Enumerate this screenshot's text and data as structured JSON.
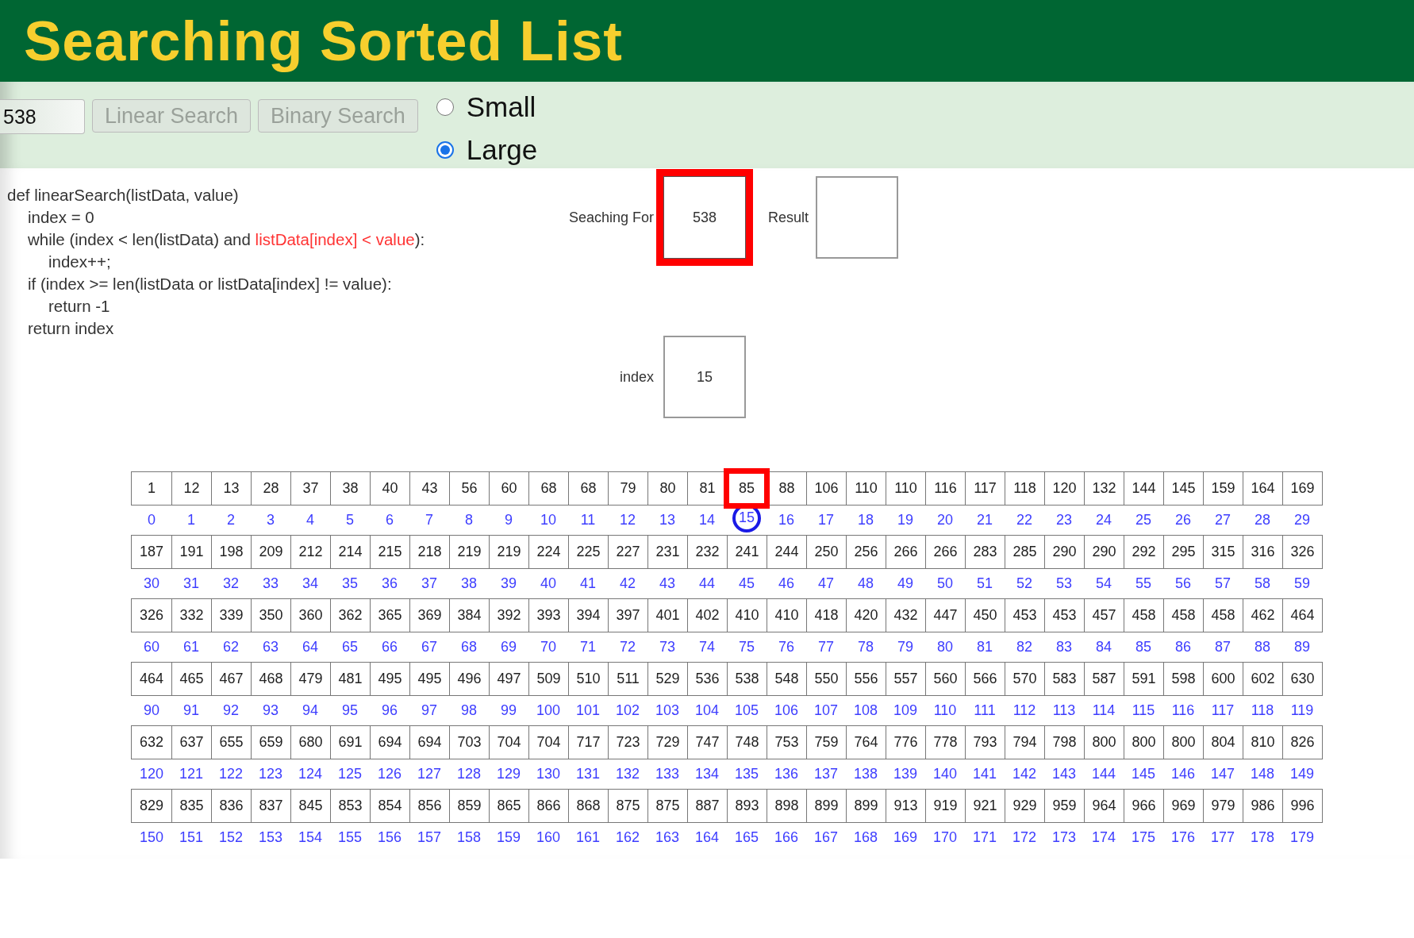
{
  "header": {
    "title": "Searching Sorted List"
  },
  "controls": {
    "value_field": {
      "value": "538"
    },
    "buttons": [
      {
        "label": "Linear Search",
        "disabled": true
      },
      {
        "label": "Binary Search",
        "disabled": true
      }
    ],
    "size_options": [
      {
        "label": "Small",
        "selected": false
      },
      {
        "label": "Large",
        "selected": true
      }
    ]
  },
  "code": {
    "lines": [
      {
        "parts": [
          {
            "text": "def linearSearch(listData, value)",
            "highlighted": false
          }
        ],
        "children": [
          {
            "parts": [
              {
                "text": "index = 0",
                "highlighted": false
              }
            ]
          },
          {
            "parts": [
              {
                "text": "while (index < len(listData) and ",
                "highlighted": false
              },
              {
                "text": "listData[index] < value",
                "highlighted": true
              },
              {
                "text": "):",
                "highlighted": false
              }
            ],
            "children": [
              {
                "parts": [
                  {
                    "text": "index++;",
                    "highlighted": false
                  }
                ]
              }
            ]
          },
          {
            "parts": [
              {
                "text": "if (index >= len(listData or listData[index] != value):",
                "highlighted": false
              }
            ],
            "children": [
              {
                "parts": [
                  {
                    "text": "return -1",
                    "highlighted": false
                  }
                ]
              }
            ]
          },
          {
            "parts": [
              {
                "text": "return index",
                "highlighted": false
              }
            ]
          }
        ]
      }
    ]
  },
  "variables": {
    "searching_for": {
      "label": "Seaching For",
      "value": "538"
    },
    "result": {
      "label": "Result"
    },
    "index": {
      "label": "index",
      "value": "15"
    }
  },
  "list": {
    "items": [
      {
        "value": "1",
        "index": "0",
        "selected": false
      },
      {
        "value": "12",
        "index": "1",
        "selected": false
      },
      {
        "value": "13",
        "index": "2",
        "selected": false
      },
      {
        "value": "28",
        "index": "3",
        "selected": false
      },
      {
        "value": "37",
        "index": "4",
        "selected": false
      },
      {
        "value": "38",
        "index": "5",
        "selected": false
      },
      {
        "value": "40",
        "index": "6",
        "selected": false
      },
      {
        "value": "43",
        "index": "7",
        "selected": false
      },
      {
        "value": "56",
        "index": "8",
        "selected": false
      },
      {
        "value": "60",
        "index": "9",
        "selected": false
      },
      {
        "value": "68",
        "index": "10",
        "selected": false
      },
      {
        "value": "68",
        "index": "11",
        "selected": false
      },
      {
        "value": "79",
        "index": "12",
        "selected": false
      },
      {
        "value": "80",
        "index": "13",
        "selected": false
      },
      {
        "value": "81",
        "index": "14",
        "selected": false
      },
      {
        "value": "85",
        "index": "15",
        "selected": true
      },
      {
        "value": "88",
        "index": "16",
        "selected": false
      },
      {
        "value": "106",
        "index": "17",
        "selected": false
      },
      {
        "value": "110",
        "index": "18",
        "selected": false
      },
      {
        "value": "110",
        "index": "19",
        "selected": false
      },
      {
        "value": "116",
        "index": "20",
        "selected": false
      },
      {
        "value": "117",
        "index": "21",
        "selected": false
      },
      {
        "value": "118",
        "index": "22",
        "selected": false
      },
      {
        "value": "120",
        "index": "23",
        "selected": false
      },
      {
        "value": "132",
        "index": "24",
        "selected": false
      },
      {
        "value": "144",
        "index": "25",
        "selected": false
      },
      {
        "value": "145",
        "index": "26",
        "selected": false
      },
      {
        "value": "159",
        "index": "27",
        "selected": false
      },
      {
        "value": "164",
        "index": "28",
        "selected": false
      },
      {
        "value": "169",
        "index": "29",
        "selected": false
      },
      {
        "value": "187",
        "index": "30",
        "selected": false
      },
      {
        "value": "191",
        "index": "31",
        "selected": false
      },
      {
        "value": "198",
        "index": "32",
        "selected": false
      },
      {
        "value": "209",
        "index": "33",
        "selected": false
      },
      {
        "value": "212",
        "index": "34",
        "selected": false
      },
      {
        "value": "214",
        "index": "35",
        "selected": false
      },
      {
        "value": "215",
        "index": "36",
        "selected": false
      },
      {
        "value": "218",
        "index": "37",
        "selected": false
      },
      {
        "value": "219",
        "index": "38",
        "selected": false
      },
      {
        "value": "219",
        "index": "39",
        "selected": false
      },
      {
        "value": "224",
        "index": "40",
        "selected": false
      },
      {
        "value": "225",
        "index": "41",
        "selected": false
      },
      {
        "value": "227",
        "index": "42",
        "selected": false
      },
      {
        "value": "231",
        "index": "43",
        "selected": false
      },
      {
        "value": "232",
        "index": "44",
        "selected": false
      },
      {
        "value": "241",
        "index": "45",
        "selected": false
      },
      {
        "value": "244",
        "index": "46",
        "selected": false
      },
      {
        "value": "250",
        "index": "47",
        "selected": false
      },
      {
        "value": "256",
        "index": "48",
        "selected": false
      },
      {
        "value": "266",
        "index": "49",
        "selected": false
      },
      {
        "value": "266",
        "index": "50",
        "selected": false
      },
      {
        "value": "283",
        "index": "51",
        "selected": false
      },
      {
        "value": "285",
        "index": "52",
        "selected": false
      },
      {
        "value": "290",
        "index": "53",
        "selected": false
      },
      {
        "value": "290",
        "index": "54",
        "selected": false
      },
      {
        "value": "292",
        "index": "55",
        "selected": false
      },
      {
        "value": "295",
        "index": "56",
        "selected": false
      },
      {
        "value": "315",
        "index": "57",
        "selected": false
      },
      {
        "value": "316",
        "index": "58",
        "selected": false
      },
      {
        "value": "326",
        "index": "59",
        "selected": false
      },
      {
        "value": "326",
        "index": "60",
        "selected": false
      },
      {
        "value": "332",
        "index": "61",
        "selected": false
      },
      {
        "value": "339",
        "index": "62",
        "selected": false
      },
      {
        "value": "350",
        "index": "63",
        "selected": false
      },
      {
        "value": "360",
        "index": "64",
        "selected": false
      },
      {
        "value": "362",
        "index": "65",
        "selected": false
      },
      {
        "value": "365",
        "index": "66",
        "selected": false
      },
      {
        "value": "369",
        "index": "67",
        "selected": false
      },
      {
        "value": "384",
        "index": "68",
        "selected": false
      },
      {
        "value": "392",
        "index": "69",
        "selected": false
      },
      {
        "value": "393",
        "index": "70",
        "selected": false
      },
      {
        "value": "394",
        "index": "71",
        "selected": false
      },
      {
        "value": "397",
        "index": "72",
        "selected": false
      },
      {
        "value": "401",
        "index": "73",
        "selected": false
      },
      {
        "value": "402",
        "index": "74",
        "selected": false
      },
      {
        "value": "410",
        "index": "75",
        "selected": false
      },
      {
        "value": "410",
        "index": "76",
        "selected": false
      },
      {
        "value": "418",
        "index": "77",
        "selected": false
      },
      {
        "value": "420",
        "index": "78",
        "selected": false
      },
      {
        "value": "432",
        "index": "79",
        "selected": false
      },
      {
        "value": "447",
        "index": "80",
        "selected": false
      },
      {
        "value": "450",
        "index": "81",
        "selected": false
      },
      {
        "value": "453",
        "index": "82",
        "selected": false
      },
      {
        "value": "453",
        "index": "83",
        "selected": false
      },
      {
        "value": "457",
        "index": "84",
        "selected": false
      },
      {
        "value": "458",
        "index": "85",
        "selected": false
      },
      {
        "value": "458",
        "index": "86",
        "selected": false
      },
      {
        "value": "458",
        "index": "87",
        "selected": false
      },
      {
        "value": "462",
        "index": "88",
        "selected": false
      },
      {
        "value": "464",
        "index": "89",
        "selected": false
      },
      {
        "value": "464",
        "index": "90",
        "selected": false
      },
      {
        "value": "465",
        "index": "91",
        "selected": false
      },
      {
        "value": "467",
        "index": "92",
        "selected": false
      },
      {
        "value": "468",
        "index": "93",
        "selected": false
      },
      {
        "value": "479",
        "index": "94",
        "selected": false
      },
      {
        "value": "481",
        "index": "95",
        "selected": false
      },
      {
        "value": "495",
        "index": "96",
        "selected": false
      },
      {
        "value": "495",
        "index": "97",
        "selected": false
      },
      {
        "value": "496",
        "index": "98",
        "selected": false
      },
      {
        "value": "497",
        "index": "99",
        "selected": false
      },
      {
        "value": "509",
        "index": "100",
        "selected": false
      },
      {
        "value": "510",
        "index": "101",
        "selected": false
      },
      {
        "value": "511",
        "index": "102",
        "selected": false
      },
      {
        "value": "529",
        "index": "103",
        "selected": false
      },
      {
        "value": "536",
        "index": "104",
        "selected": false
      },
      {
        "value": "538",
        "index": "105",
        "selected": false
      },
      {
        "value": "548",
        "index": "106",
        "selected": false
      },
      {
        "value": "550",
        "index": "107",
        "selected": false
      },
      {
        "value": "556",
        "index": "108",
        "selected": false
      },
      {
        "value": "557",
        "index": "109",
        "selected": false
      },
      {
        "value": "560",
        "index": "110",
        "selected": false
      },
      {
        "value": "566",
        "index": "111",
        "selected": false
      },
      {
        "value": "570",
        "index": "112",
        "selected": false
      },
      {
        "value": "583",
        "index": "113",
        "selected": false
      },
      {
        "value": "587",
        "index": "114",
        "selected": false
      },
      {
        "value": "591",
        "index": "115",
        "selected": false
      },
      {
        "value": "598",
        "index": "116",
        "selected": false
      },
      {
        "value": "600",
        "index": "117",
        "selected": false
      },
      {
        "value": "602",
        "index": "118",
        "selected": false
      },
      {
        "value": "630",
        "index": "119",
        "selected": false
      },
      {
        "value": "632",
        "index": "120",
        "selected": false
      },
      {
        "value": "637",
        "index": "121",
        "selected": false
      },
      {
        "value": "655",
        "index": "122",
        "selected": false
      },
      {
        "value": "659",
        "index": "123",
        "selected": false
      },
      {
        "value": "680",
        "index": "124",
        "selected": false
      },
      {
        "value": "691",
        "index": "125",
        "selected": false
      },
      {
        "value": "694",
        "index": "126",
        "selected": false
      },
      {
        "value": "694",
        "index": "127",
        "selected": false
      },
      {
        "value": "703",
        "index": "128",
        "selected": false
      },
      {
        "value": "704",
        "index": "129",
        "selected": false
      },
      {
        "value": "704",
        "index": "130",
        "selected": false
      },
      {
        "value": "717",
        "index": "131",
        "selected": false
      },
      {
        "value": "723",
        "index": "132",
        "selected": false
      },
      {
        "value": "729",
        "index": "133",
        "selected": false
      },
      {
        "value": "747",
        "index": "134",
        "selected": false
      },
      {
        "value": "748",
        "index": "135",
        "selected": false
      },
      {
        "value": "753",
        "index": "136",
        "selected": false
      },
      {
        "value": "759",
        "index": "137",
        "selected": false
      },
      {
        "value": "764",
        "index": "138",
        "selected": false
      },
      {
        "value": "776",
        "index": "139",
        "selected": false
      },
      {
        "value": "778",
        "index": "140",
        "selected": false
      },
      {
        "value": "793",
        "index": "141",
        "selected": false
      },
      {
        "value": "794",
        "index": "142",
        "selected": false
      },
      {
        "value": "798",
        "index": "143",
        "selected": false
      },
      {
        "value": "800",
        "index": "144",
        "selected": false
      },
      {
        "value": "800",
        "index": "145",
        "selected": false
      },
      {
        "value": "800",
        "index": "146",
        "selected": false
      },
      {
        "value": "804",
        "index": "147",
        "selected": false
      },
      {
        "value": "810",
        "index": "148",
        "selected": false
      },
      {
        "value": "826",
        "index": "149",
        "selected": false
      },
      {
        "value": "829",
        "index": "150",
        "selected": false
      },
      {
        "value": "835",
        "index": "151",
        "selected": false
      },
      {
        "value": "836",
        "index": "152",
        "selected": false
      },
      {
        "value": "837",
        "index": "153",
        "selected": false
      },
      {
        "value": "845",
        "index": "154",
        "selected": false
      },
      {
        "value": "853",
        "index": "155",
        "selected": false
      },
      {
        "value": "854",
        "index": "156",
        "selected": false
      },
      {
        "value": "856",
        "index": "157",
        "selected": false
      },
      {
        "value": "859",
        "index": "158",
        "selected": false
      },
      {
        "value": "865",
        "index": "159",
        "selected": false
      },
      {
        "value": "866",
        "index": "160",
        "selected": false
      },
      {
        "value": "868",
        "index": "161",
        "selected": false
      },
      {
        "value": "875",
        "index": "162",
        "selected": false
      },
      {
        "value": "875",
        "index": "163",
        "selected": false
      },
      {
        "value": "887",
        "index": "164",
        "selected": false
      },
      {
        "value": "893",
        "index": "165",
        "selected": false
      },
      {
        "value": "898",
        "index": "166",
        "selected": false
      },
      {
        "value": "899",
        "index": "167",
        "selected": false
      },
      {
        "value": "899",
        "index": "168",
        "selected": false
      },
      {
        "value": "913",
        "index": "169",
        "selected": false
      },
      {
        "value": "919",
        "index": "170",
        "selected": false
      },
      {
        "value": "921",
        "index": "171",
        "selected": false
      },
      {
        "value": "929",
        "index": "172",
        "selected": false
      },
      {
        "value": "959",
        "index": "173",
        "selected": false
      },
      {
        "value": "964",
        "index": "174",
        "selected": false
      },
      {
        "value": "966",
        "index": "175",
        "selected": false
      },
      {
        "value": "969",
        "index": "176",
        "selected": false
      },
      {
        "value": "979",
        "index": "177",
        "selected": false
      },
      {
        "value": "986",
        "index": "178",
        "selected": false
      },
      {
        "value": "996",
        "index": "179",
        "selected": false
      }
    ]
  }
}
